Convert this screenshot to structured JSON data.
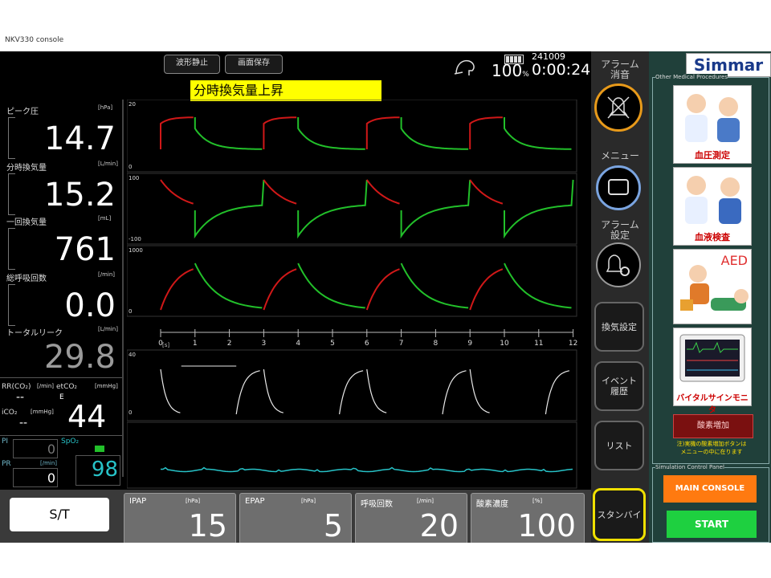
{
  "window": {
    "title": "NKV330 console"
  },
  "header": {
    "freeze_button": "波形静止",
    "save_screen_button": "画面保存",
    "alarm_banner": "分時換気量上昇",
    "spo2_value": "100",
    "spo2_unit": "%",
    "clock_id": "241009",
    "clock": "0:00:24"
  },
  "left_params": [
    {
      "label": "ピーク圧",
      "unit": "[hPa]",
      "value": "14.7"
    },
    {
      "label": "分時換気量",
      "unit": "[L/min]",
      "value": "15.2"
    },
    {
      "label": "一回換気量",
      "unit": "[mL]",
      "value": "761"
    },
    {
      "label": "総呼吸回数",
      "unit": "[/min]",
      "value": "0.0"
    },
    {
      "label": "トータルリーク",
      "unit": "[L/min]",
      "value": "29.8"
    }
  ],
  "co2": {
    "rr_label": "RR(CO₂)",
    "rr_unit": "[/min]",
    "etco2_label": "etCO₂",
    "etco2_unit": "[mmHg]",
    "rr_value": "--",
    "rr_value_suffix": "E",
    "ico2_label": "iCO₂",
    "ico2_unit": "[mmHg]",
    "dashes": "--",
    "etco2_value": "44"
  },
  "spo2_panel": {
    "pi_label": "PI",
    "pi_value": "0",
    "pr_label": "PR",
    "pr_unit": "[/min]",
    "pr_value": "0",
    "spo2_label": "SpO₂",
    "spo2_value": "98"
  },
  "waveforms": {
    "pressure_scale_top": "20",
    "pressure_scale_bottom": "0",
    "flow_scale_top": "100",
    "flow_scale_bottom": "-100",
    "volume_scale_top": "1000",
    "volume_scale_bottom": "0",
    "time_ticks": [
      "0",
      "1",
      "2",
      "3",
      "4",
      "5",
      "6",
      "7",
      "8",
      "9",
      "10",
      "11",
      "12"
    ],
    "time_unit": "[s]",
    "co2_scale_top": "40",
    "co2_scale_bottom": "0"
  },
  "bottom": {
    "mode": "S/T",
    "settings": [
      {
        "label": "IPAP",
        "unit": "[hPa]",
        "value": "15"
      },
      {
        "label": "EPAP",
        "unit": "[hPa]",
        "value": "5"
      },
      {
        "label": "呼吸回数",
        "unit": "[/min]",
        "value": "20"
      },
      {
        "label": "酸素濃度",
        "unit": "[%]",
        "value": "100"
      }
    ],
    "standby_button": "スタンバイ"
  },
  "side_menu": {
    "alarm_silence_label": "アラーム\n消音",
    "menu_label": "メニュー",
    "alarm_settings_label": "アラーム\n設定",
    "vent_settings_button": "換気設定",
    "event_history_button": "イベント\n履歴",
    "list_button": "リスト"
  },
  "right_panel": {
    "brand": "Simmar",
    "other_section_title": "Other Medical Procedures",
    "cards": [
      {
        "label": "血圧測定"
      },
      {
        "label": "血液検査"
      },
      {
        "label": "AED"
      },
      {
        "label": "バイタルサインモニタ"
      }
    ],
    "red_button": "酸素増加",
    "note": "注)実機の酸素増加ボタンは\nメニューの中に在ります",
    "sim_section_title": "Simulation Control Panel",
    "main_console_button": "MAIN CONSOLE",
    "start_button": "START"
  },
  "colors": {
    "wave_insp": "#d01818",
    "wave_exp": "#22c02a",
    "co2_wave": "#e8e8e8",
    "spo2_wave": "#27c3c8",
    "banner": "#ffff00",
    "spo2_text": "#27c3c8"
  }
}
